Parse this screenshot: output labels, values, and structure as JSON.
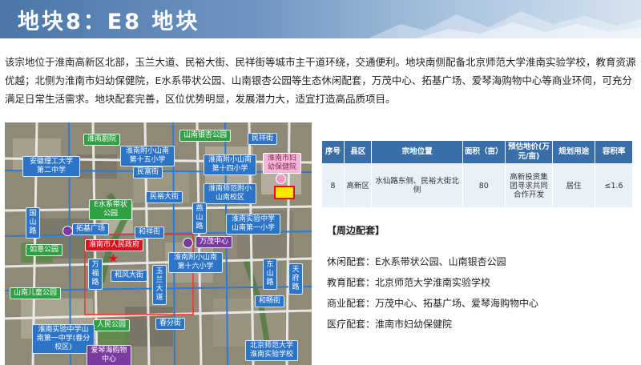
{
  "header": {
    "title": "地块8：E8 地块"
  },
  "intro": "该宗地位于淮南高新区北部，玉兰大道、民裕大街、民祥街等城市主干道环绕，交通便利。地块南侧配备北京师范大学淮南实验学校，教育资源优越；北侧为淮南市妇幼保健院，E水系带状公园、山南银杏公园等生态休闲配套，万茂中心、拓基广场、爱琴海购物中心等商业环伺，可充分满足日常生活需求。地块配套完善，区位优势明显，发展潜力大，适宜打造高品质项目。",
  "map": {
    "labels": {
      "huainan_juyuan": "淮南剧院",
      "shannan_yinxing": "山南银杏公园",
      "minxiang_jie": "民祥街",
      "anhui_lg": "安徽理工大学第二中学",
      "huainan_fuxiao_15": "淮南附小山南第十五小学",
      "huainan_fuxiao_14": "淮南附小山南第十四小学",
      "minfu_jie": "民富街",
      "fuyou": "淮南市妇幼保健院",
      "minyu_dajie": "民裕大街",
      "nanshida_fushu": "淮南师范附小山南校区",
      "e_shuixi": "E水系带状公园",
      "guoshan_lu": "国山路",
      "yanshan_lu": "燕山路",
      "tuoji": "拓基广场",
      "hexiang_jie": "和祥街",
      "wanmao": "万茂中心",
      "shiyan_zhong1": "淮南实验中学山南第一小学",
      "gov": "淮南市人民政府",
      "ruyi": "如意公园",
      "fuxiao_16": "淮南附小山南第十六小学",
      "wanfu_lu": "万福路",
      "hefeng": "和风大街",
      "yulan": "玉兰大道",
      "dongshan": "东山路",
      "tianfu": "天府路",
      "shannan_ertong": "山南儿童公园",
      "renmin": "人民公园",
      "chunfen": "春分街",
      "hehui": "和畅街",
      "aiqinhai": "爱琴海购物中心",
      "shiyan_zhongxue": "淮南实验中学山南第一中学(春分校区)",
      "bsd": "北京师范大学淮南实验学校"
    }
  },
  "table": {
    "headers": [
      "序号",
      "县区",
      "宗地位置",
      "面积（亩）",
      "预估地价(万元/亩)",
      "规划用途",
      "容积率"
    ],
    "row": [
      "8",
      "高新区",
      "水仙路东侧、民裕大街北侧",
      "80",
      "高新投资集团寻求共同合作开发",
      "居住",
      "≤1.6"
    ]
  },
  "surroundings": {
    "title": "【周边配套】",
    "items": [
      {
        "key": "休闲配套：",
        "value": "E水系带状公园、山南银杏公园"
      },
      {
        "key": "教育配套：",
        "value": "北京师范大学淮南实验学校"
      },
      {
        "key": "商业配套：",
        "value": "万茂中心、拓基广场、爱琴海购物中心"
      },
      {
        "key": "医疗配套：",
        "value": "淮南市妇幼保健院"
      }
    ]
  }
}
